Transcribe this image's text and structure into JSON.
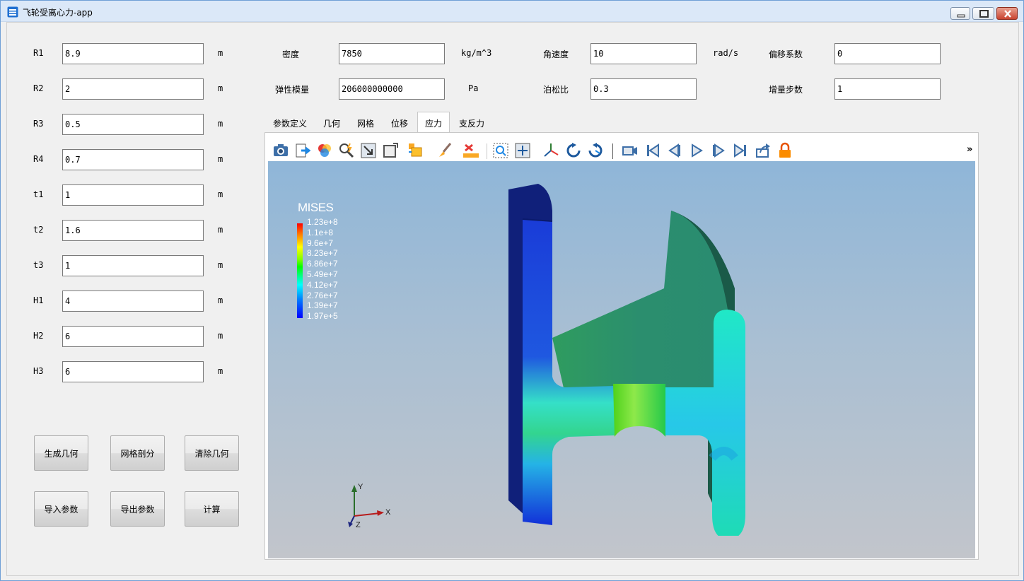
{
  "window": {
    "title": "飞轮受离心力-app"
  },
  "params_left": [
    {
      "label": "R1",
      "value": "8.9",
      "unit": "m"
    },
    {
      "label": "R2",
      "value": "2",
      "unit": "m"
    },
    {
      "label": "R3",
      "value": "0.5",
      "unit": "m"
    },
    {
      "label": "R4",
      "value": "0.7",
      "unit": "m"
    },
    {
      "label": "t1",
      "value": "1",
      "unit": "m"
    },
    {
      "label": "t2",
      "value": "1.6",
      "unit": "m"
    },
    {
      "label": "t3",
      "value": "1",
      "unit": "m"
    },
    {
      "label": "H1",
      "value": "4",
      "unit": "m"
    },
    {
      "label": "H2",
      "value": "6",
      "unit": "m"
    },
    {
      "label": "H3",
      "value": "6",
      "unit": "m"
    }
  ],
  "material": {
    "density": {
      "label": "密度",
      "value": "7850",
      "unit": "kg/m^3"
    },
    "modulus": {
      "label": "弹性模量",
      "value": "206000000000",
      "unit": "Pa"
    },
    "angular_velocity": {
      "label": "角速度",
      "value": "10",
      "unit": "rad/s"
    },
    "poisson": {
      "label": "泊松比",
      "value": "0.3"
    },
    "offset_factor": {
      "label": "偏移系数",
      "value": "0"
    },
    "increment_steps": {
      "label": "增量步数",
      "value": "1"
    }
  },
  "buttons": {
    "generate_geometry": "生成几何",
    "mesh": "网格剖分",
    "clear_geometry": "清除几何",
    "import_params": "导入参数",
    "export_params": "导出参数",
    "compute": "计算"
  },
  "tabs": [
    {
      "label": "参数定义",
      "active": false
    },
    {
      "label": "几何",
      "active": false
    },
    {
      "label": "网格",
      "active": false
    },
    {
      "label": "位移",
      "active": false
    },
    {
      "label": "应力",
      "active": true
    },
    {
      "label": "支反力",
      "active": false
    }
  ],
  "toolbar": {
    "icons": [
      "camera-icon",
      "export-icon",
      "color-map-icon",
      "pick-icon",
      "resize-icon",
      "outline-icon",
      "box-select-icon",
      "brush-icon",
      "ruler-icon",
      "zoom-box-icon",
      "pan-icon",
      "axes-icon",
      "rotate-cw-icon",
      "rotate-ccw-icon",
      "video-camera-icon",
      "first-frame-icon",
      "prev-frame-icon",
      "play-icon",
      "next-frame-icon",
      "last-frame-icon",
      "share-icon",
      "lock-icon"
    ],
    "more": "»"
  },
  "legend": {
    "title": "MISES",
    "labels": [
      "1.23e+8",
      "1.1e+8",
      "9.6e+7",
      "8.23e+7",
      "6.86e+7",
      "5.49e+7",
      "4.12e+7",
      "2.76e+7",
      "1.39e+7",
      "1.97e+5"
    ]
  },
  "axes": {
    "x": "X",
    "y": "Y",
    "z": "Z"
  }
}
